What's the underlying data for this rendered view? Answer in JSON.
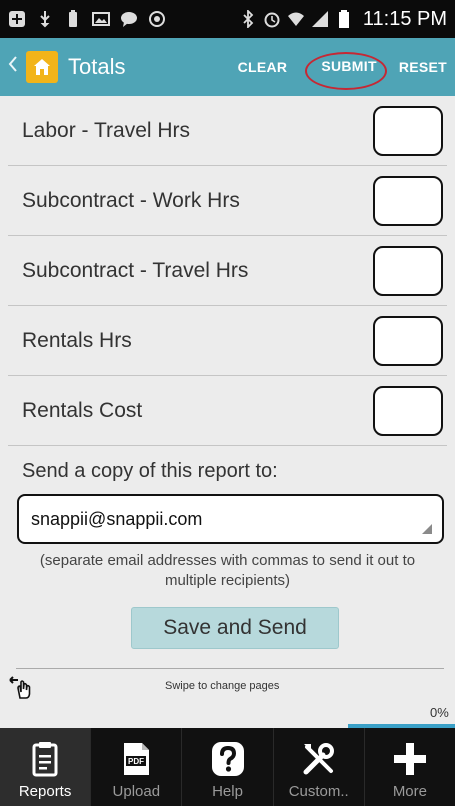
{
  "status_bar": {
    "time": "11:15 PM"
  },
  "action_bar": {
    "title": "Totals",
    "clear_label": "CLEAR",
    "submit_label": "SUBMIT",
    "reset_label": "RESET"
  },
  "form": {
    "rows": [
      {
        "label": "Labor - Travel Hrs",
        "value": ""
      },
      {
        "label": "Subcontract - Work Hrs",
        "value": ""
      },
      {
        "label": "Subcontract - Travel Hrs",
        "value": ""
      },
      {
        "label": "Rentals Hrs",
        "value": ""
      },
      {
        "label": "Rentals Cost",
        "value": ""
      }
    ],
    "send_label": "Send a copy of this report to:",
    "email_value": "snappii@snappii.com",
    "hint": "(separate email addresses with commas to send it out to multiple recipients)",
    "save_button": "Save and Send"
  },
  "footer": {
    "swipe_text": "Swipe to change pages",
    "progress_percent": "0%"
  },
  "bottom_tabs": [
    {
      "label": "Reports",
      "icon": "clipboard-icon",
      "active": true
    },
    {
      "label": "Upload",
      "icon": "pdf-icon",
      "active": false
    },
    {
      "label": "Help",
      "icon": "question-icon",
      "active": false
    },
    {
      "label": "Custom..",
      "icon": "tools-icon",
      "active": false
    },
    {
      "label": "More",
      "icon": "plus-icon",
      "active": false
    }
  ],
  "colors": {
    "action_bar": "#4fa4b6",
    "submit_highlight": "#c62834",
    "save_button": "#b7d9dc",
    "progress": "#3aa0c7"
  }
}
